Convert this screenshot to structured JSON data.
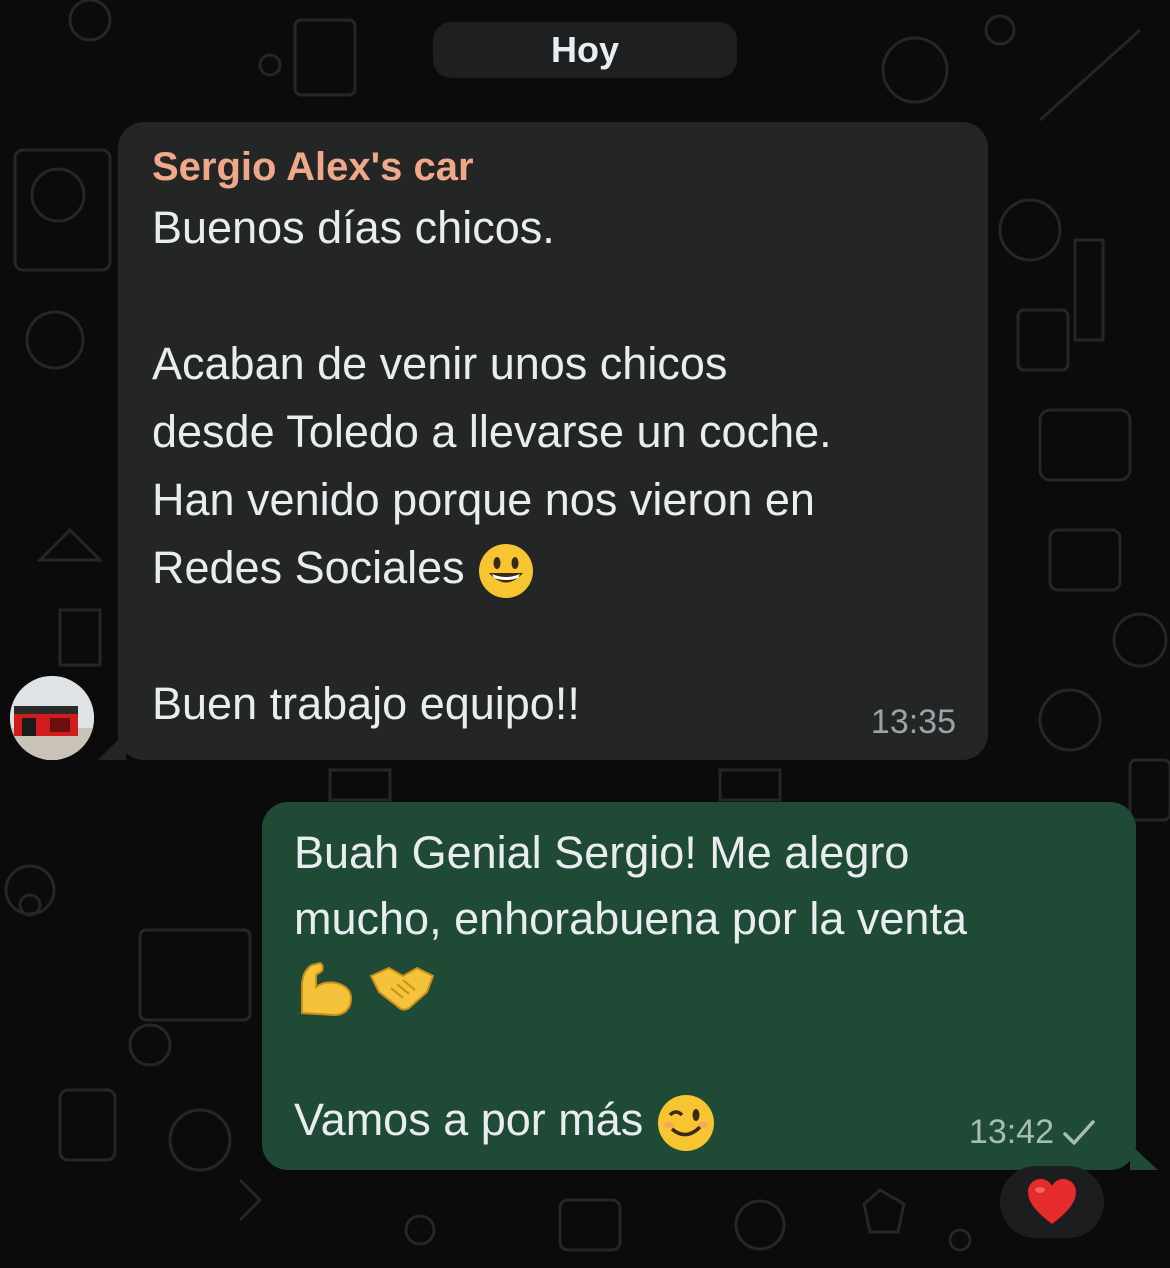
{
  "date_separator": "Hoy",
  "incoming_message": {
    "sender": "Sergio Alex's car",
    "lines": [
      "Buenos días chicos.",
      "",
      "Acaban de venir unos chicos",
      "desde Toledo a llevarse un coche.",
      "Han venido porque nos vieron en",
      "Redes Sociales",
      "",
      "Buen trabajo equipo!!"
    ],
    "emoji": "grinning-face-icon",
    "time": "13:35"
  },
  "outgoing_message": {
    "line1": "Buah Genial Sergio! Me alegro",
    "line2": "mucho, enhorabuena por la venta",
    "line3_emojis": [
      "flexed-biceps-icon",
      "handshake-icon"
    ],
    "line5": "Vamos a por más",
    "line5_emoji": "winking-face-icon",
    "time": "13:42",
    "status": "sent-check-icon"
  },
  "reaction": {
    "emoji": "red-heart-icon"
  },
  "colors": {
    "background": "#0b0b0b",
    "incoming_bubble": "#242626",
    "outgoing_bubble": "#1f4a35",
    "sender_name": "#f0a88a",
    "timestamp": "#9aa3a8"
  }
}
